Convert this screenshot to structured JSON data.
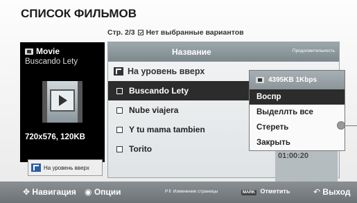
{
  "screen": {
    "title": "СПИСОК ФИЛЬМОВ",
    "page_info": "Стр. 2/3",
    "selection_status": "Нет выбранные вариантов"
  },
  "preview": {
    "type_label": "Movie",
    "file_title": "Buscando Lety",
    "resolution": "720x576, 120KB",
    "up_button_label": "На уровень вверх"
  },
  "list": {
    "col_name": "Название",
    "col_duration": "Продолжительность",
    "up_item": "На уровень вверх",
    "items": [
      {
        "label": "Buscando Lety",
        "selected": true
      },
      {
        "label": "Nube viajera",
        "selected": false
      },
      {
        "label": "Y tu mama tambien",
        "selected": false
      },
      {
        "label": "Torito",
        "selected": false
      }
    ],
    "partial_duration": "01:00:20"
  },
  "popup": {
    "info": "4395KB 1Kbps",
    "items": [
      "Воспр",
      "Выделлть все",
      "Стереть",
      "Закрыть"
    ],
    "active_index": 0
  },
  "bottom": {
    "navigation": "Навигация",
    "options": "Опции",
    "page_change": "Изменение страницы",
    "mark_tag": "MARK",
    "mark": "Отметить",
    "exit": "Выход"
  },
  "icons": {
    "movie": "film-icon",
    "up": "folder-up-icon",
    "nav": "dpad-icon",
    "options": "options-icon",
    "exit": "return-icon"
  },
  "colors": {
    "header_bar": "#8b9599",
    "selected_row": "#2c2c2c",
    "bottom_bar": "#6d7276"
  }
}
